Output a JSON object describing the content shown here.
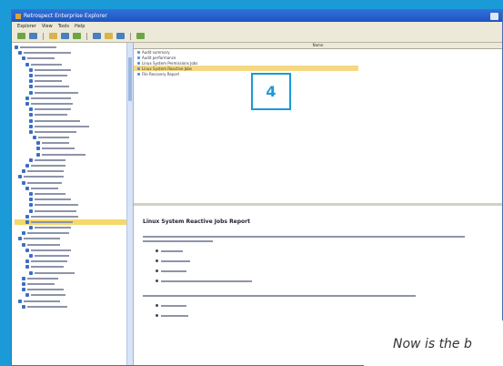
{
  "window": {
    "title": "Retrospect Enterprise Explorer"
  },
  "menu": [
    "Explorer",
    "View",
    "Tools",
    "Help"
  ],
  "list": {
    "column_header": "Name",
    "rows": [
      "Audit summary",
      "Audit performance",
      "Linux System Permissions Jobs",
      "Linux System Reactive Jobs",
      "File Recovery Report"
    ],
    "selected_index": 3
  },
  "badge": {
    "number": "4"
  },
  "detail": {
    "heading": "Linux System Reactive Jobs Report"
  },
  "caption": {
    "text": "Now is the b"
  },
  "colors": {
    "desktop": "#1a9ad6",
    "selection": "#f6d884",
    "titlebar": "#1f55c0"
  }
}
